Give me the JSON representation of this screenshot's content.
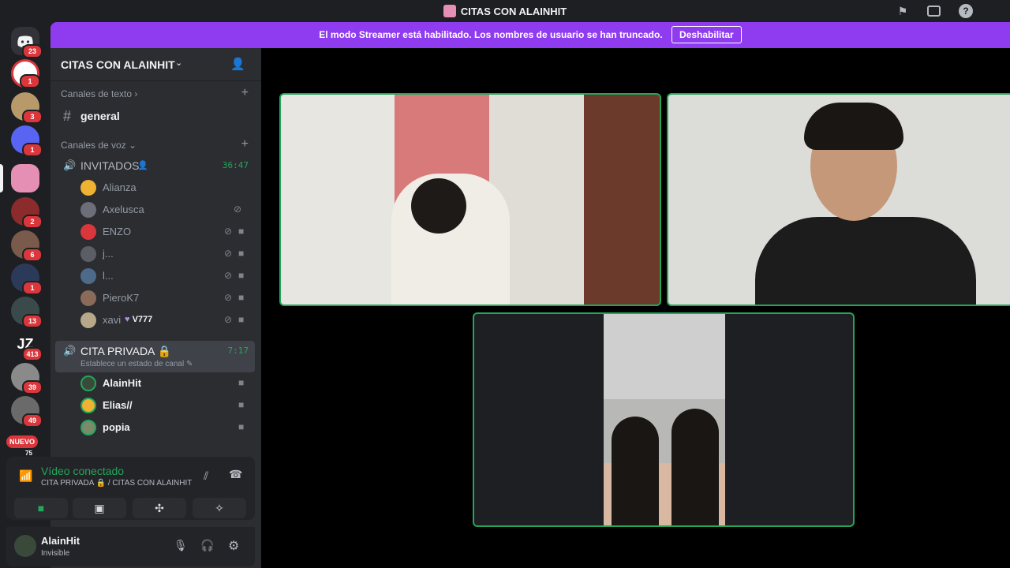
{
  "titlebar": {
    "title": "CITAS CON ALAINHIT"
  },
  "banner": {
    "text": "El modo Streamer está habilitado. Los nombres de usuario se han truncado.",
    "button": "Deshabilitar"
  },
  "guilds": [
    {
      "badge": "23"
    },
    {
      "badge": "1"
    },
    {
      "badge": "3"
    },
    {
      "badge": "1"
    },
    {
      "badge": ""
    },
    {
      "badge": "2"
    },
    {
      "badge": "6"
    },
    {
      "badge": "1"
    },
    {
      "badge": "13"
    },
    {
      "badge": "413",
      "label": "JZ"
    },
    {
      "badge": "39"
    },
    {
      "badge": "49"
    }
  ],
  "nuevo_badge": "NUEVO",
  "nuevo_count": "75",
  "server": {
    "name": "CITAS CON ALAINHIT"
  },
  "categories": {
    "text": "Canales de texto",
    "voice": "Canales de voz"
  },
  "text_channel": {
    "name": "general"
  },
  "voice_channels": [
    {
      "name": "INVITADOS",
      "timer": "36:47",
      "users": [
        {
          "name": "Alianza",
          "avatar_color": "#f0b232",
          "muted": false,
          "video": false
        },
        {
          "name": "Axelusca",
          "avatar_color": "#6d6f78",
          "muted": true,
          "video": false
        },
        {
          "name": "ENZO",
          "avatar_color": "#da373c",
          "muted": true,
          "video": true
        },
        {
          "name": "j...",
          "avatar_color": "#5c5e66",
          "muted": true,
          "video": true
        },
        {
          "name": "l...",
          "avatar_color": "#4e6a8a",
          "muted": true,
          "video": true
        },
        {
          "name": "PieroK7",
          "avatar_color": "#8a6b5a",
          "muted": true,
          "video": true
        },
        {
          "name": "xavi",
          "tag": "V777",
          "avatar_color": "#b8a88a",
          "muted": true,
          "video": true
        }
      ]
    },
    {
      "name": "CITA PRIVADA",
      "timer": "7:17",
      "status": "Establece un estado de canal",
      "users": [
        {
          "name": "AlainHit",
          "avatar_color": "#3a4a3a"
        },
        {
          "name": "Elias//",
          "avatar_color": "#f0b232"
        },
        {
          "name": "popia",
          "avatar_color": "#7a8a6a"
        }
      ]
    }
  ],
  "voice_status": {
    "title": "Vídeo conectado",
    "subtitle": "CITA PRIVADA 🔒 / CITAS CON ALAINHIT"
  },
  "user_panel": {
    "name": "AlainHit",
    "status": "Invisible"
  },
  "icons": {
    "speaker": "speaker-icon",
    "mute": "mic-off-icon",
    "video": "camera-icon",
    "settings": "gear-icon",
    "headphones": "headphones-icon",
    "mic": "mic-icon"
  }
}
